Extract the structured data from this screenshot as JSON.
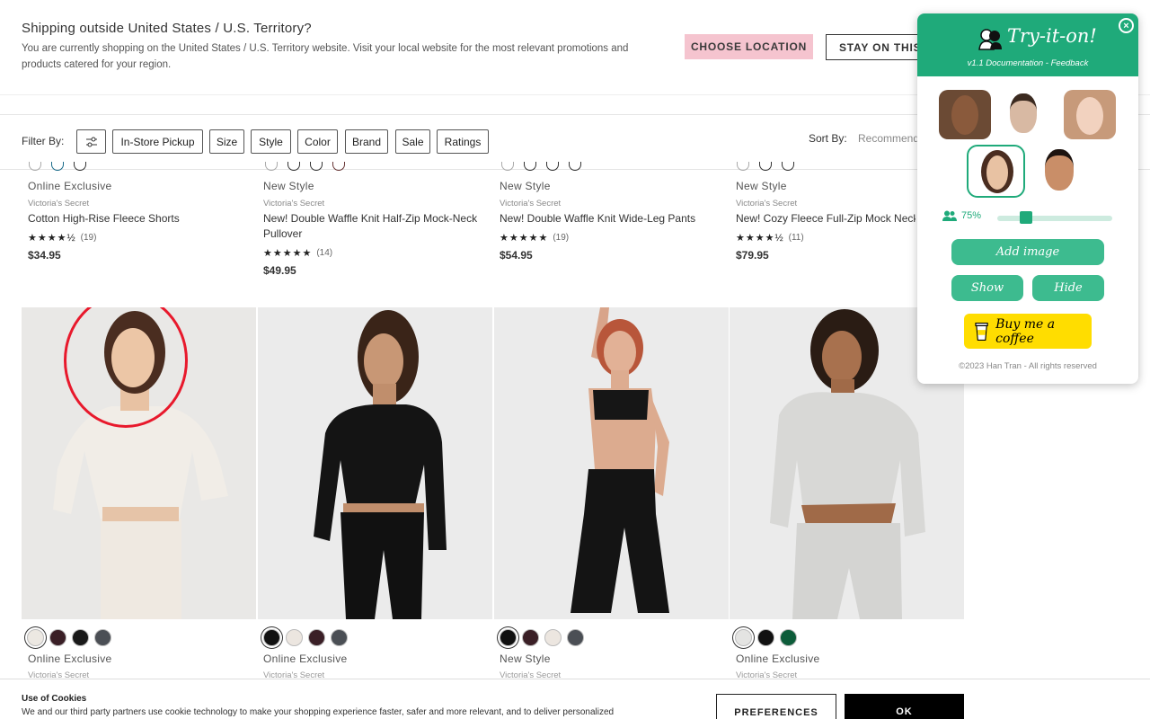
{
  "banner": {
    "title": "Shipping outside United States / U.S. Territory?",
    "body": "You are currently shopping on the United States / U.S. Territory website. Visit your local website for the most relevant promotions and products catered for your region.",
    "choose_label": "CHOOSE LOCATION",
    "stay_label": "STAY ON THIS SITE"
  },
  "filters": {
    "label": "Filter By:",
    "chips": [
      "In-Store Pickup",
      "Size",
      "Style",
      "Color",
      "Brand",
      "Sale",
      "Ratings"
    ],
    "sort_label": "Sort By:",
    "sort_value": "Recommended"
  },
  "top_products": [
    {
      "badge": "Online Exclusive",
      "brand": "Victoria's Secret",
      "name": "Cotton High-Rise Fleece Shorts",
      "stars": "★★★★½",
      "rating": 4.5,
      "reviews": "(19)",
      "price": "$34.95"
    },
    {
      "badge": "New Style",
      "brand": "Victoria's Secret",
      "name": "New! Double Waffle Knit Half-Zip Mock-Neck Pullover",
      "stars": "★★★★★",
      "rating": 5,
      "reviews": "(14)",
      "price": "$49.95"
    },
    {
      "badge": "New Style",
      "brand": "Victoria's Secret",
      "name": "New! Double Waffle Knit Wide-Leg Pants",
      "stars": "★★★★★",
      "rating": 5,
      "reviews": "(19)",
      "price": "$54.95"
    },
    {
      "badge": "New Style",
      "brand": "Victoria's Secret",
      "name": "New! Cozy Fleece Full-Zip Mock Neck Jacket",
      "stars": "★★★★½",
      "rating": 4.5,
      "reviews": "(11)",
      "price": "$79.95"
    }
  ],
  "bottom_products": [
    {
      "badge": "Online Exclusive",
      "brand": "Victoria's Secret",
      "swatches": [
        "#ece8e2",
        "#3a1f26",
        "#1a1a1a",
        "#4b4f55"
      ]
    },
    {
      "badge": "Online Exclusive",
      "brand": "Victoria's Secret",
      "swatches": [
        "#111111",
        "#ece6e0",
        "#3a1f26",
        "#4b4f55"
      ]
    },
    {
      "badge": "New Style",
      "brand": "Victoria's Secret",
      "swatches": [
        "#111111",
        "#3a1f26",
        "#ece6e0",
        "#4b4f55"
      ]
    },
    {
      "badge": "Online Exclusive",
      "brand": "Victoria's Secret",
      "swatches": [
        "#e4e4e2",
        "#111111",
        "#0d5c3a"
      ]
    }
  ],
  "cookies": {
    "title": "Use of Cookies",
    "body": "We and our third party partners use cookie technology to make your shopping experience faster, safer and more relevant, and to deliver personalized",
    "preferences_label": "PREFERENCES",
    "ok_label": "OK"
  },
  "extension": {
    "title": "Try-it-on!",
    "subtitle": "v1.1 Documentation - Feedback",
    "opacity": "75%",
    "opacity_value": 0.75,
    "add_image_label": "Add image",
    "show_label": "Show",
    "hide_label": "Hide",
    "coffee_label": "Buy me a coffee",
    "footer": "©2023 Han Tran - All rights reserved",
    "accent": "#1faa7a"
  },
  "colors": {
    "choose_button": "#f5c4cf",
    "highlight_circle": "#e8192c"
  }
}
